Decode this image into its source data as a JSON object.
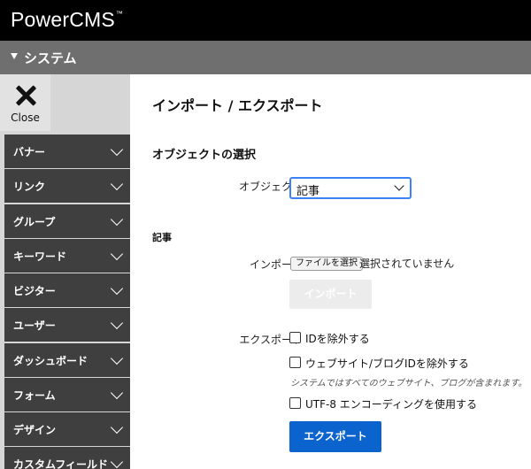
{
  "header": {
    "brand": "PowerCMS",
    "brand_tm": "™"
  },
  "scope": {
    "label": "システム"
  },
  "sidebar": {
    "close_label": "Close",
    "items": [
      {
        "label": "バナー"
      },
      {
        "label": "リンク"
      },
      {
        "label": "グループ"
      },
      {
        "label": "キーワード"
      },
      {
        "label": "ビジター"
      },
      {
        "label": "ユーザー"
      },
      {
        "label": "ダッシュボード"
      },
      {
        "label": "フォーム"
      },
      {
        "label": "デザイン"
      },
      {
        "label": "カスタムフィールド"
      }
    ]
  },
  "main": {
    "title": "インポート / エクスポート",
    "object_section": {
      "title": "オブジェクトの選択",
      "object_label": "オブジェクト",
      "object_value": "記事"
    },
    "entry_section": {
      "title": "記事",
      "import_label": "インポート",
      "file_button": "ファイルを選択",
      "file_status": "選択されていません",
      "import_button": "インポート",
      "export_label": "エクスポート",
      "options": [
        {
          "label": "IDを除外する",
          "checked": false
        },
        {
          "label": "ウェブサイト/ブログIDを除外する",
          "checked": false
        },
        {
          "label": "UTF-8 エンコーディングを使用する",
          "checked": false
        }
      ],
      "hint": "システムではすべてのウェブサイト、ブログが含まれます。",
      "export_button": "エクスポート"
    }
  }
}
